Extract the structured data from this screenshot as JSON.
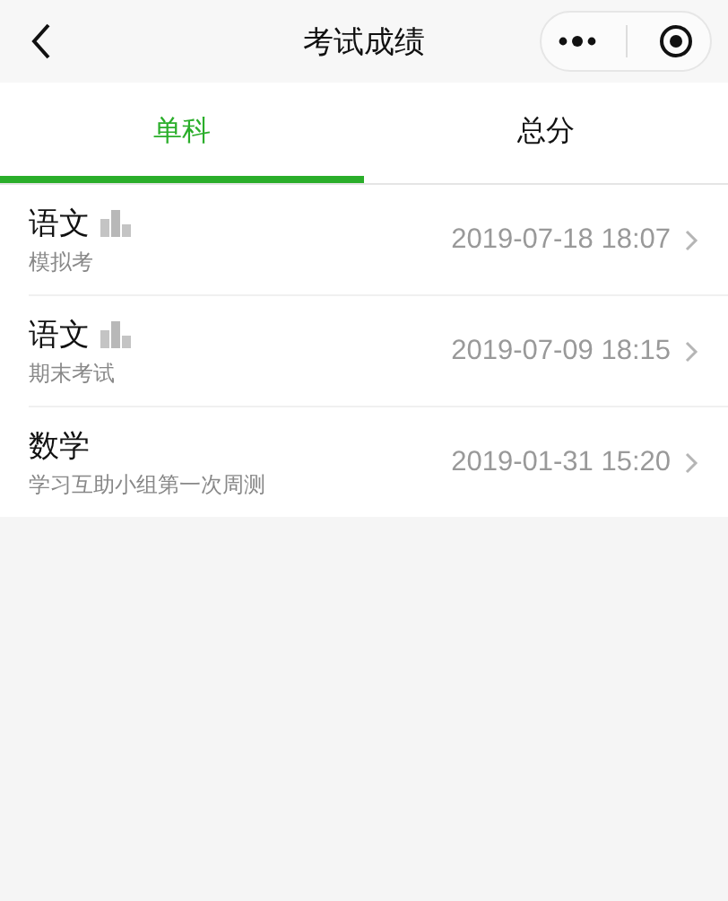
{
  "nav_bar": {
    "title": "考试成绩"
  },
  "tabs": [
    {
      "label": "单科",
      "selected": true
    },
    {
      "label": "总分",
      "selected": false
    }
  ],
  "exams": [
    {
      "subject": "语文",
      "rank_icon": true,
      "name": "模拟考",
      "time": "2019-07-18 18:07"
    },
    {
      "subject": "语文",
      "rank_icon": true,
      "name": "期末考试",
      "time": "2019-07-09 18:15"
    },
    {
      "subject": "数学",
      "rank_icon": false,
      "name": "学习互助小组第一次周测",
      "time": "2019-01-31 15:20"
    }
  ]
}
